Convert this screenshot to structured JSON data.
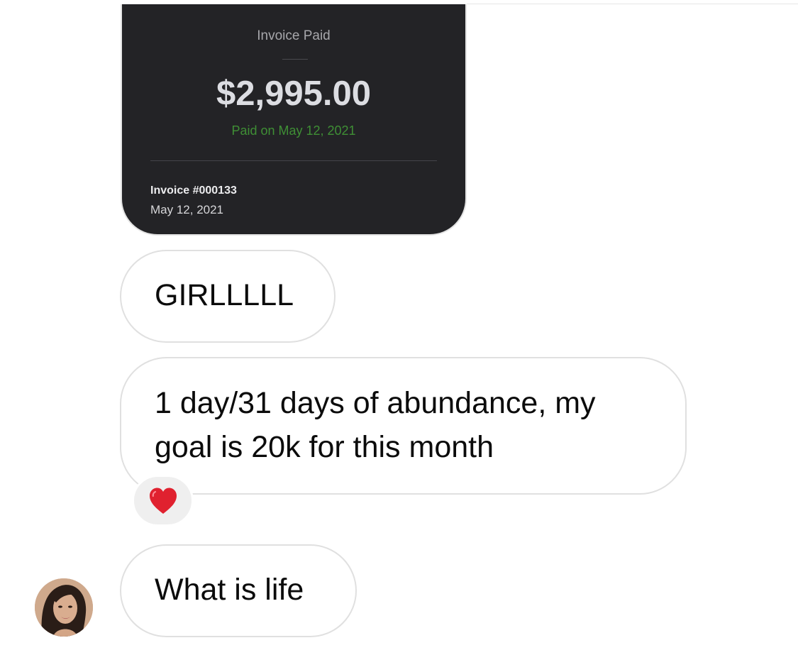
{
  "invoice": {
    "status": "Invoice Paid",
    "amount": "$2,995.00",
    "paid_on": "Paid on May 12, 2021",
    "number": "Invoice #000133",
    "date": "May 12, 2021"
  },
  "messages": [
    {
      "text": "GIRLLLLL"
    },
    {
      "text": "1 day/31 days of abundance, my goal is 20k for this month",
      "reaction": "heart-icon"
    },
    {
      "text": "What is life"
    }
  ],
  "colors": {
    "card_background": "#232326",
    "paid_green": "#3f8f35",
    "bubble_border": "#e0e0e0",
    "reaction_background": "#efefef",
    "heart": "#e0212f"
  }
}
